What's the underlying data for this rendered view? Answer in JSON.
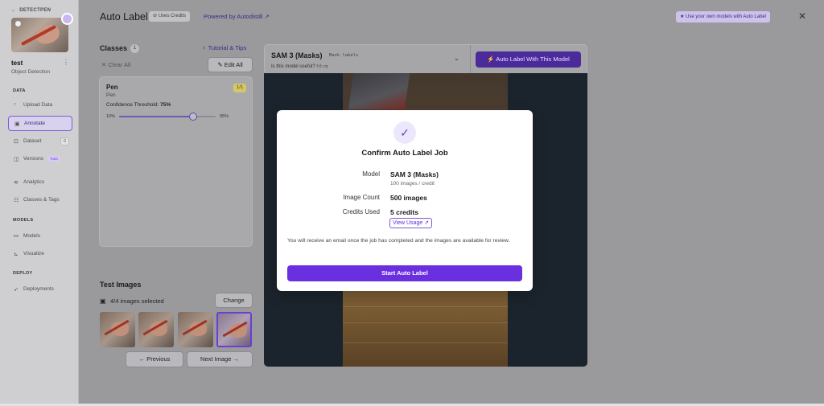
{
  "sidebar": {
    "workspace": "DETECTPEN",
    "project_name": "test",
    "project_type": "Object Detection",
    "kebab_glyph": "⋮",
    "sections": {
      "data": "DATA",
      "models": "MODELS",
      "deploy": "DEPLOY"
    },
    "items": [
      {
        "label": "Upload Data",
        "icon": "upload-icon"
      },
      {
        "label": "Annotate",
        "icon": "annotate-icon"
      },
      {
        "label": "Dataset",
        "icon": "dataset-icon",
        "badge": "0"
      },
      {
        "label": "Versions",
        "icon": "versions-icon",
        "pill": "Train"
      },
      {
        "label": "Analytics",
        "icon": "analytics-icon"
      },
      {
        "label": "Classes & Tags",
        "icon": "classes-icon"
      },
      {
        "label": "Models",
        "icon": "models-icon"
      },
      {
        "label": "Visualize",
        "icon": "visualize-icon"
      },
      {
        "label": "Deployments",
        "icon": "deployments-icon"
      }
    ]
  },
  "header": {
    "title": "Auto Label",
    "uses_credits": "Uses Credits",
    "powered_by": "Powered by Autodistill ↗",
    "own_models": "Use your own models with Auto Label",
    "close_glyph": "✕"
  },
  "classes": {
    "heading": "Classes",
    "count": "1",
    "tutorial": "Tutorial & Tips",
    "clear_all": "✕  Clear All",
    "edit_all": "Edit All",
    "item": {
      "name": "Pen",
      "sub": "Pen",
      "ratio": "1/1",
      "confidence_label": "Confidence Threshold:",
      "confidence_value": "75%",
      "min": "10%",
      "max": "95%",
      "slider_fraction": 0.765
    }
  },
  "test_images": {
    "heading": "Test Images",
    "selected": "4/4 images selected",
    "change": "Change",
    "previous": "←   Previous",
    "next": "Next Image   →"
  },
  "model_bar": {
    "name": "SAM 3 (Masks)",
    "tag": "Mask labels",
    "useful": "Is this model useful?",
    "run_button": "Auto Label With This Model"
  },
  "modal": {
    "title": "Confirm Auto Label Job",
    "model_label": "Model",
    "model_value": "SAM 3 (Masks)",
    "model_sub": "100 images / credit",
    "count_label": "Image Count",
    "count_value": "500 images",
    "credits_label": "Credits Used",
    "credits_value": "5 credits",
    "view_usage": "View Usage ↗",
    "message": "You will receive an email once the job has completed and the images are available for review.",
    "start_button": "Start Auto Label"
  },
  "colors": {
    "accent": "#6a30e0",
    "accent_dark": "#4b2a9c"
  }
}
